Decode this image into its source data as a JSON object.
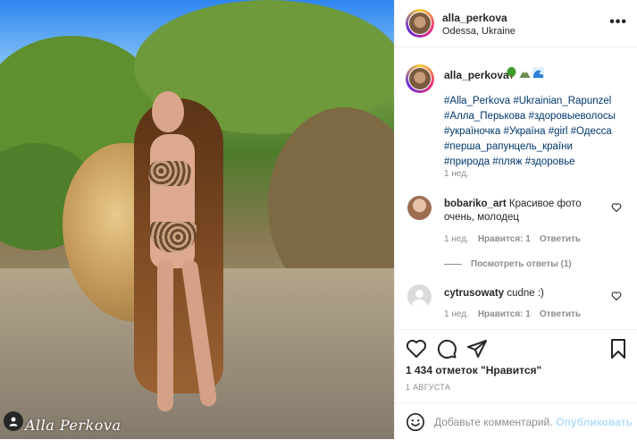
{
  "post": {
    "author": "alla_perkova",
    "location": "Odessa, Ukraine",
    "more_icon": "more-horizontal-icon",
    "watermark": "Alla Perkova",
    "caption": {
      "username": "alla_perkova",
      "emojis": [
        "tree-emoji",
        "mountain-emoji",
        "wave-emoji"
      ],
      "hashtags": [
        "#Alla_Perkova",
        "#Ukrainian_Rapunzel",
        "#Алла_Перькова",
        "#здоровыеволосы",
        "#україночка",
        "#Украïна",
        "#girl",
        "#Одесса",
        "#перша_рапунцель_країни",
        "#природа",
        "#пляж",
        "#здоровье"
      ],
      "time": "1 нед."
    },
    "comments": [
      {
        "username": "bobariko_art",
        "text": "Красивое фото очень, молодец",
        "time": "1 нед.",
        "likes": "Нравится: 1",
        "reply": "Ответить",
        "view_replies": "Посмотреть ответы (1)"
      },
      {
        "username": "cytrusowaty",
        "text": "cudne :)",
        "time": "1 нед.",
        "likes": "Нравится: 1",
        "reply": "Ответить"
      }
    ],
    "likes_text": "1 434 отметок \"Нравится\"",
    "date": "1 АВГУСТА",
    "composer": {
      "placeholder": "Добавьте комментарий...",
      "publish": "Опубликовать"
    },
    "colors": {
      "link": "#00376b",
      "muted": "#8e8e8e",
      "publish_disabled": "#b2dffc",
      "border": "#efefef"
    }
  }
}
